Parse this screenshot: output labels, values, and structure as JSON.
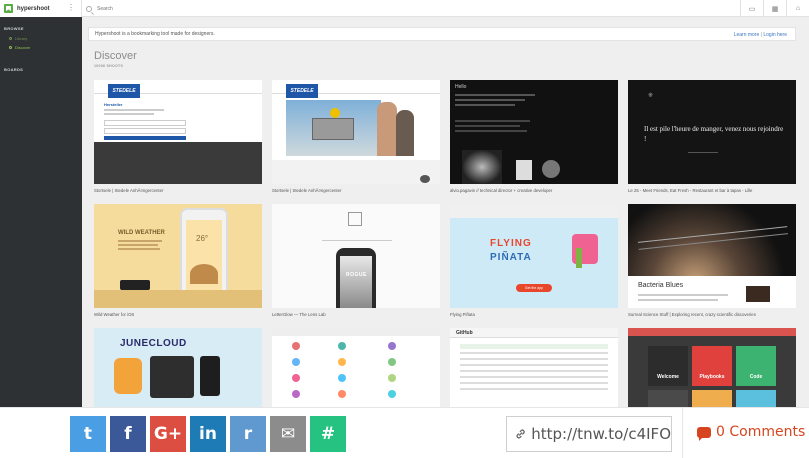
{
  "app": {
    "name": "hypershoot"
  },
  "search": {
    "placeholder": "Search"
  },
  "sidebar": {
    "browse_heading": "BROWSE",
    "items": [
      {
        "label": "Library"
      },
      {
        "label": "Discover"
      }
    ],
    "boards_heading": "BOARDS"
  },
  "banner": {
    "text": "Hypershoot is a bookmarking tool made for designers.",
    "learn_more": "Learn more",
    "divider": "|",
    "login": "Login here"
  },
  "main": {
    "title": "Discover",
    "subtitle": "10096 SHOOTS"
  },
  "cards": [
    {
      "caption": "Stortsele | Stedele AnhÃ¤ngercenter",
      "thumb": "trailer-site",
      "thumb_text": {
        "logo": "STEDELE",
        "heading": "Hersteller"
      }
    },
    {
      "caption": "Stortsele | Stedele AnhÃ¤ngercenter",
      "thumb": "trailer-photo",
      "thumb_text": {
        "logo": "STEDELE"
      }
    },
    {
      "caption": "alvio.pagavin // technical director + creative developer",
      "thumb": "dark-code",
      "thumb_text": {
        "heading": "Hello"
      }
    },
    {
      "caption": "Le 25 - Meet Friends, Eat Fresh - Restaurant et bar à tapas - Lille",
      "thumb": "restaurant",
      "thumb_text": {
        "heading": "Il est pile l'heure de manger, venez nous rejoindre !"
      }
    },
    {
      "caption": "Wild Weather for iOS",
      "thumb": "weather-app",
      "thumb_text": {
        "heading": "WILD WEATHER",
        "temp": "26°"
      }
    },
    {
      "caption": "LetterGlow — The Lens Lab",
      "thumb": "phone-mockup",
      "thumb_text": {
        "heading": "ROGUE"
      }
    },
    {
      "caption": "Flying Piñata",
      "thumb": "flying-pinata",
      "thumb_text": {
        "heading": "FLYING",
        "heading2": "PIÑATA",
        "button": "Get the app"
      }
    },
    {
      "caption": "Surreal Science Stuff | Exploring recent, crazy scientific discoveries",
      "thumb": "planet",
      "thumb_text": {
        "heading": "Bacteria Blues"
      }
    },
    {
      "caption": "",
      "thumb": "june-cloud",
      "thumb_text": {
        "heading": "JUNECLOUD"
      }
    },
    {
      "caption": "",
      "thumb": "icon-grid",
      "thumb_text": {}
    },
    {
      "caption": "",
      "thumb": "github-list",
      "thumb_text": {
        "heading": "GitHub"
      }
    },
    {
      "caption": "",
      "thumb": "playbooks",
      "thumb_text": {
        "tile1": "Welcome",
        "tile2": "Playbooks",
        "tile3": "Code"
      }
    }
  ],
  "share": {
    "buttons": [
      {
        "name": "twitter",
        "color": "#4a9ee3",
        "glyph": "t"
      },
      {
        "name": "facebook",
        "color": "#3b5998",
        "glyph": "f"
      },
      {
        "name": "google-plus",
        "color": "#dc4e41",
        "glyph": "G+"
      },
      {
        "name": "linkedin",
        "color": "#1f7bb6",
        "glyph": "in"
      },
      {
        "name": "reddit",
        "color": "#5f99cf",
        "glyph": "r"
      },
      {
        "name": "email",
        "color": "#8c8c8c",
        "glyph": "✉"
      },
      {
        "name": "hashtag",
        "color": "#26c281",
        "glyph": "#"
      }
    ],
    "short_url": "http://tnw.to/c4IFO",
    "comments": "0 Comments"
  }
}
